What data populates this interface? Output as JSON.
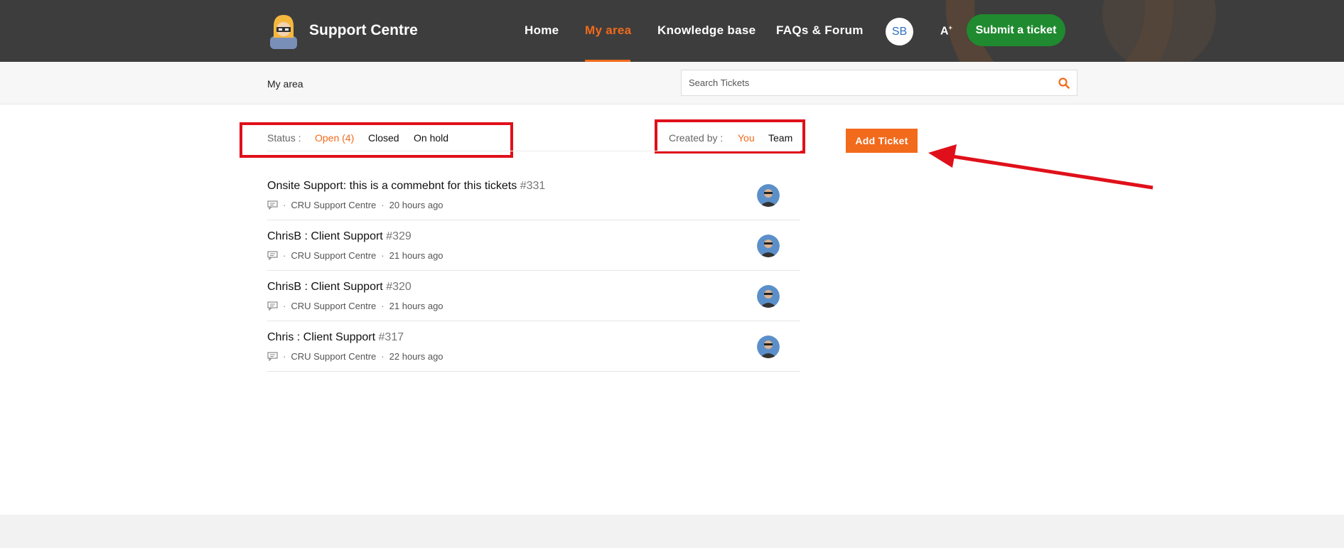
{
  "header": {
    "brand": "Support Centre",
    "nav": [
      "Home",
      "My area",
      "Knowledge base",
      "FAQs & Forum"
    ],
    "avatar_initials": "SB",
    "font_toggle": "A",
    "submit_label": "Submit a ticket"
  },
  "subbar": {
    "breadcrumb": "My area",
    "search_placeholder": "Search Tickets"
  },
  "filters": {
    "status_label": "Status :",
    "status_options": [
      "Open (4)",
      "Closed",
      "On hold"
    ],
    "created_label": "Created by :",
    "created_options": [
      "You",
      "Team"
    ]
  },
  "add_ticket_label": "Add Ticket",
  "tickets": [
    {
      "title": "Onsite Support: this is a commebnt for this tickets",
      "number": "#331",
      "team": "CRU Support Centre",
      "time": "20 hours ago"
    },
    {
      "title": "ChrisB : Client Support",
      "number": "#329",
      "team": "CRU Support Centre",
      "time": "21 hours ago"
    },
    {
      "title": "ChrisB : Client Support",
      "number": "#320",
      "team": "CRU Support Centre",
      "time": "21 hours ago"
    },
    {
      "title": "Chris : Client Support",
      "number": "#317",
      "team": "CRU Support Centre",
      "time": "22 hours ago"
    }
  ],
  "colors": {
    "accent": "#f26a1b",
    "submit": "#1f8a2f",
    "header": "#3d3d3d",
    "annotation": "#e0101a"
  }
}
